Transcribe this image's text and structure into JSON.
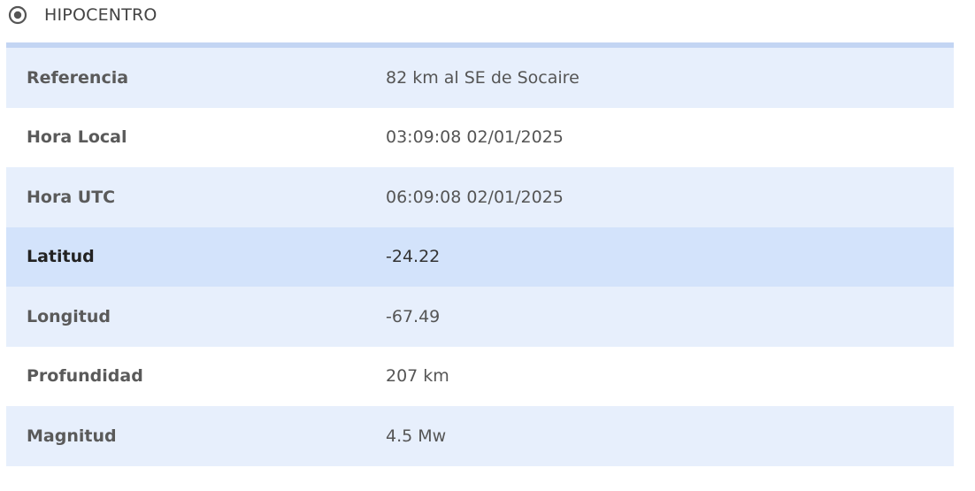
{
  "section": {
    "title": "HIPOCENTRO",
    "icon": "radio-target-icon"
  },
  "colors": {
    "row_alt": "#e7effc",
    "row_highlight": "#d3e3fb",
    "top_border": "#c3d5f3"
  },
  "rows": [
    {
      "label": "Referencia",
      "value": "82 km al SE de Socaire"
    },
    {
      "label": "Hora Local",
      "value": "03:09:08 02/01/2025"
    },
    {
      "label": "Hora UTC",
      "value": "06:09:08 02/01/2025"
    },
    {
      "label": "Latitud",
      "value": "-24.22"
    },
    {
      "label": "Longitud",
      "value": "-67.49"
    },
    {
      "label": "Profundidad",
      "value": "207 km"
    },
    {
      "label": "Magnitud",
      "value": "4.5 Mw"
    }
  ]
}
